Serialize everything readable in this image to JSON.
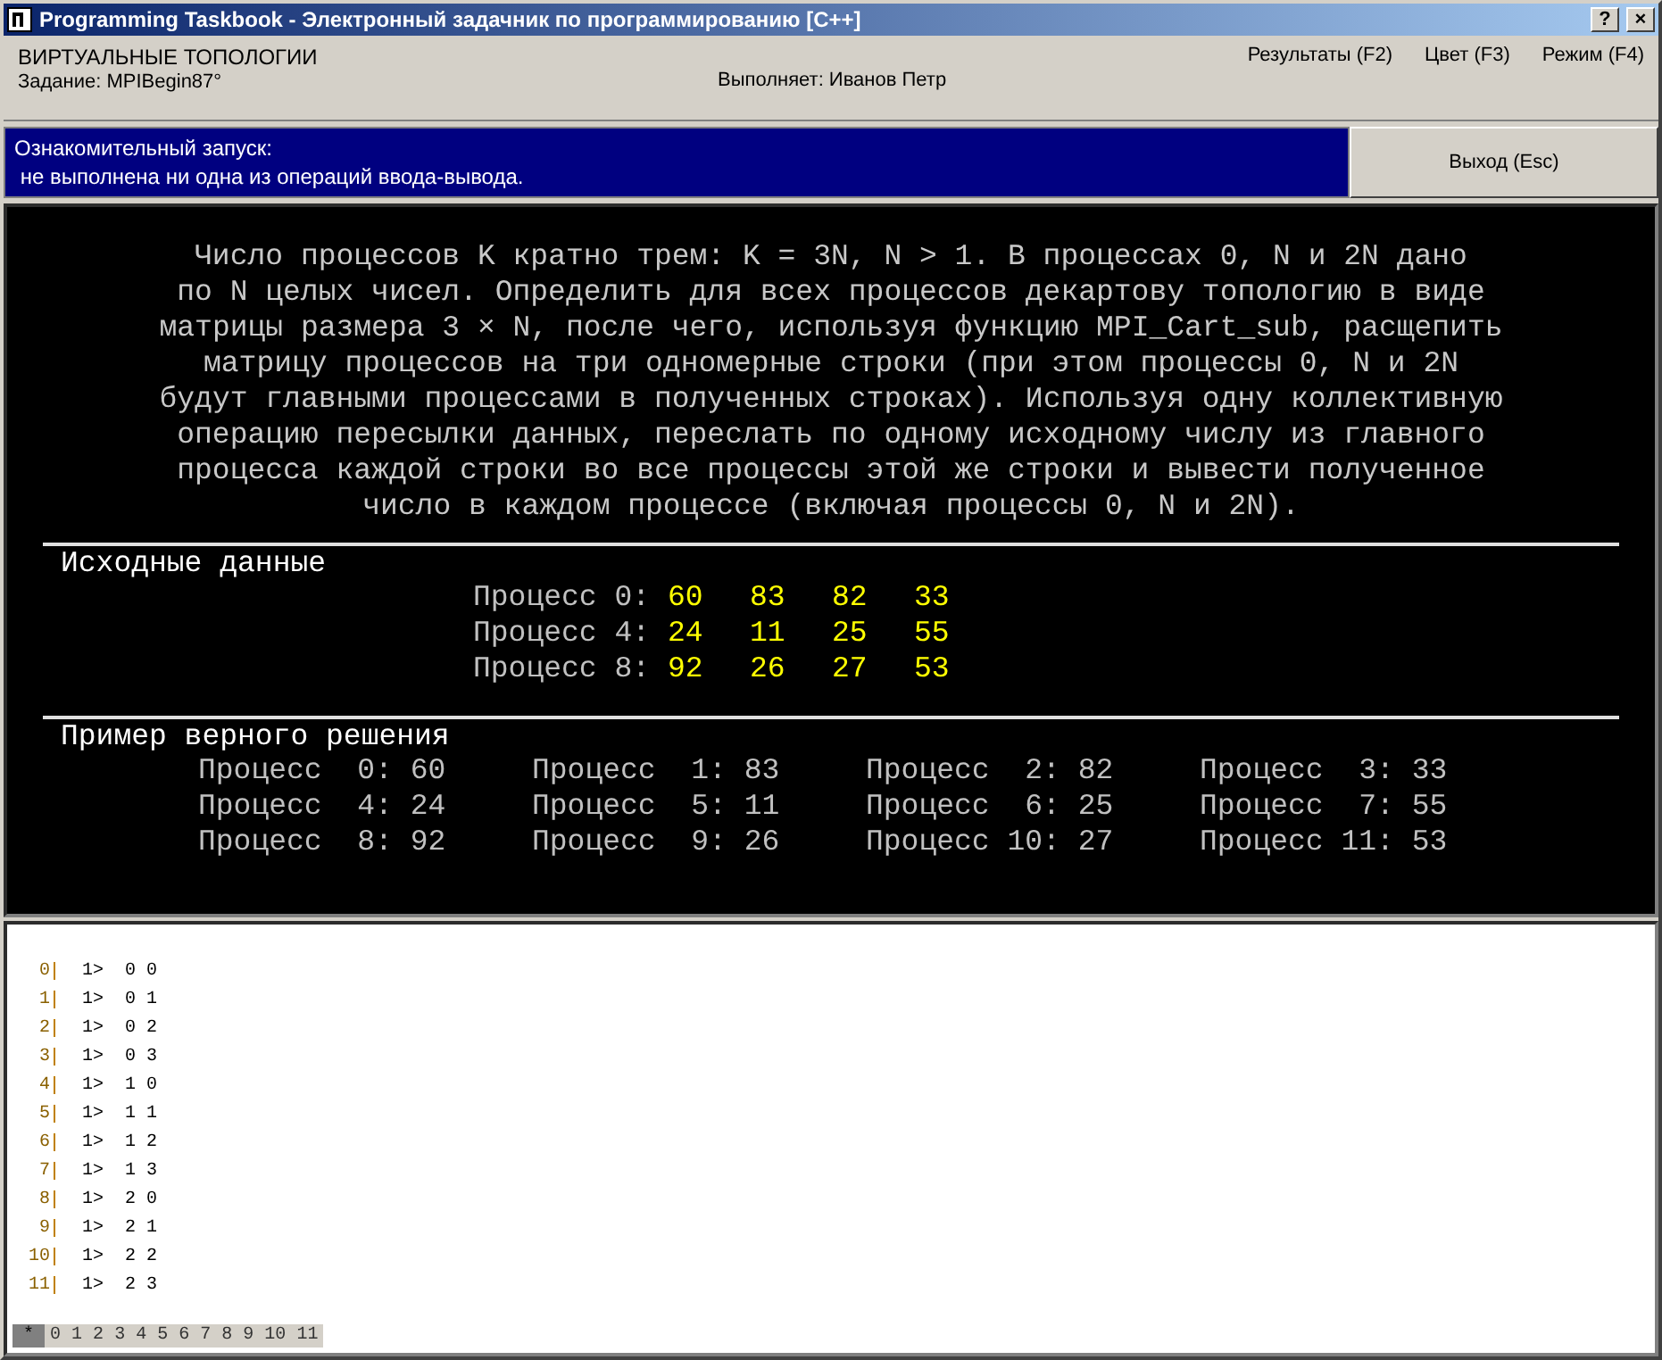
{
  "window": {
    "title": "Programming Taskbook - Электронный задачник по программированию [C++]",
    "buttons": [
      "?",
      "×"
    ]
  },
  "header": {
    "group": "ВИРТУАЛЬНЫЕ ТОПОЛОГИИ",
    "task": "Задание: MPIBegin87°",
    "author": "Выполняет: Иванов Петр",
    "menu": [
      "Результаты (F2)",
      "Цвет (F3)",
      "Режим (F4)"
    ]
  },
  "status": {
    "lines": [
      "Ознакомительный запуск:",
      " не выполнена ни одна из операций ввода-вывода."
    ],
    "exit_button": "Выход (Esc)"
  },
  "task_text": [
    "Число процессов K кратно трем: K = 3N, N > 1. В процессах 0, N и 2N дано",
    "по N целых чисел. Определить для всех процессов декартову топологию в виде",
    "матрицы размера 3 × N, после чего, используя функцию MPI_Cart_sub, расщепить",
    "матрицу процессов на три одномерные строки (при этом процессы 0, N и 2N",
    "будут главными процессами в полученных строках). Используя одну коллективную",
    "операцию пересылки данных, переслать по одному исходному числу из главного",
    "процесса каждой строки во все процессы этой же строки и вывести полученное",
    "число в каждом процессе (включая процессы 0, N и 2N)."
  ],
  "input": {
    "title": "Исходные данные",
    "rows": [
      {
        "label": "Процесс 0:",
        "values": [
          "60",
          "83",
          "82",
          "33"
        ]
      },
      {
        "label": "Процесс 4:",
        "values": [
          "24",
          "11",
          "25",
          "55"
        ]
      },
      {
        "label": "Процесс 8:",
        "values": [
          "92",
          "26",
          "27",
          "53"
        ]
      }
    ]
  },
  "example": {
    "title": "Пример верного решения",
    "rows": [
      [
        "Процесс  0: 60",
        "Процесс  1: 83",
        "Процесс  2: 82",
        "Процесс  3: 33"
      ],
      [
        "Процесс  4: 24",
        "Процесс  5: 11",
        "Процесс  6: 25",
        "Процесс  7: 55"
      ],
      [
        "Процесс  8: 92",
        "Процесс  9: 26",
        "Процесс 10: 27",
        "Процесс 11: 53"
      ]
    ]
  },
  "log": [
    {
      "proc": "0",
      "prefix": "1>",
      "text": "0 0"
    },
    {
      "proc": "1",
      "prefix": "1>",
      "text": "0 1"
    },
    {
      "proc": "2",
      "prefix": "1>",
      "text": "0 2"
    },
    {
      "proc": "3",
      "prefix": "1>",
      "text": "0 3"
    },
    {
      "proc": "4",
      "prefix": "1>",
      "text": "1 0"
    },
    {
      "proc": "5",
      "prefix": "1>",
      "text": "1 1"
    },
    {
      "proc": "6",
      "prefix": "1>",
      "text": "1 2"
    },
    {
      "proc": "7",
      "prefix": "1>",
      "text": "1 3"
    },
    {
      "proc": "8",
      "prefix": "1>",
      "text": "2 0"
    },
    {
      "proc": "9",
      "prefix": "1>",
      "text": "2 1"
    },
    {
      "proc": "10",
      "prefix": "1>",
      "text": "2 2"
    },
    {
      "proc": "11",
      "prefix": "1>",
      "text": "2 3"
    }
  ],
  "process_tabs": [
    {
      "label": "*",
      "selected": true
    },
    {
      "label": "0",
      "selected": false
    },
    {
      "label": "1",
      "selected": false
    },
    {
      "label": "2",
      "selected": false
    },
    {
      "label": "3",
      "selected": false
    },
    {
      "label": "4",
      "selected": false
    },
    {
      "label": "5",
      "selected": false
    },
    {
      "label": "6",
      "selected": false
    },
    {
      "label": "7",
      "selected": false
    },
    {
      "label": "8",
      "selected": false
    },
    {
      "label": "9",
      "selected": false
    },
    {
      "label": "10",
      "selected": false
    },
    {
      "label": "11",
      "selected": false
    }
  ]
}
